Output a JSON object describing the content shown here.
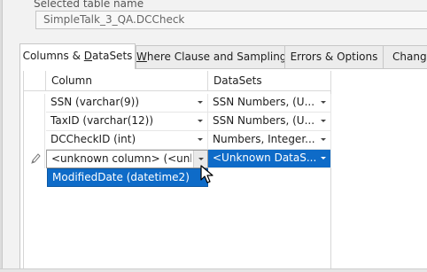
{
  "selected_table": {
    "label": "Selected table name",
    "value": "SimpleTalk_3_QA.DCCheck"
  },
  "tabs": [
    {
      "label_main": "Columns & ",
      "label_u": "D",
      "label_rest": "ataSets",
      "active": true
    },
    {
      "label_main": "",
      "label_u": "W",
      "label_rest": "here Clause and Sampling",
      "active": false
    },
    {
      "label_main": "Errors & Options",
      "label_u": "",
      "label_rest": "",
      "active": false
    },
    {
      "label_main": "Chang",
      "label_u": "",
      "label_rest": "",
      "active": false
    }
  ],
  "grid": {
    "headers": [
      "Column",
      "DataSets"
    ],
    "rows": [
      {
        "column": "SSN  (varchar(9))",
        "datasets": "SSN Numbers, (U..."
      },
      {
        "column": "TaxID  (varchar(12))",
        "datasets": "SSN Numbers, (U..."
      },
      {
        "column": "DCCheckID  (int)",
        "datasets": "Numbers, Integer..."
      }
    ],
    "editing_row": {
      "column": "<unknown column> (<unk...",
      "datasets": "<Unknown DataS..."
    },
    "dropdown_option": "ModifiedDate  (datetime2)"
  },
  "colors": {
    "selection": "#0e6bc8",
    "panel_bg": "#ffffff",
    "window_bg": "#f2f2f2"
  },
  "icons": {
    "row_indicator": "pencil-icon",
    "dropdown": "chevron-down-icon",
    "pointer": "mouse-cursor-icon"
  }
}
